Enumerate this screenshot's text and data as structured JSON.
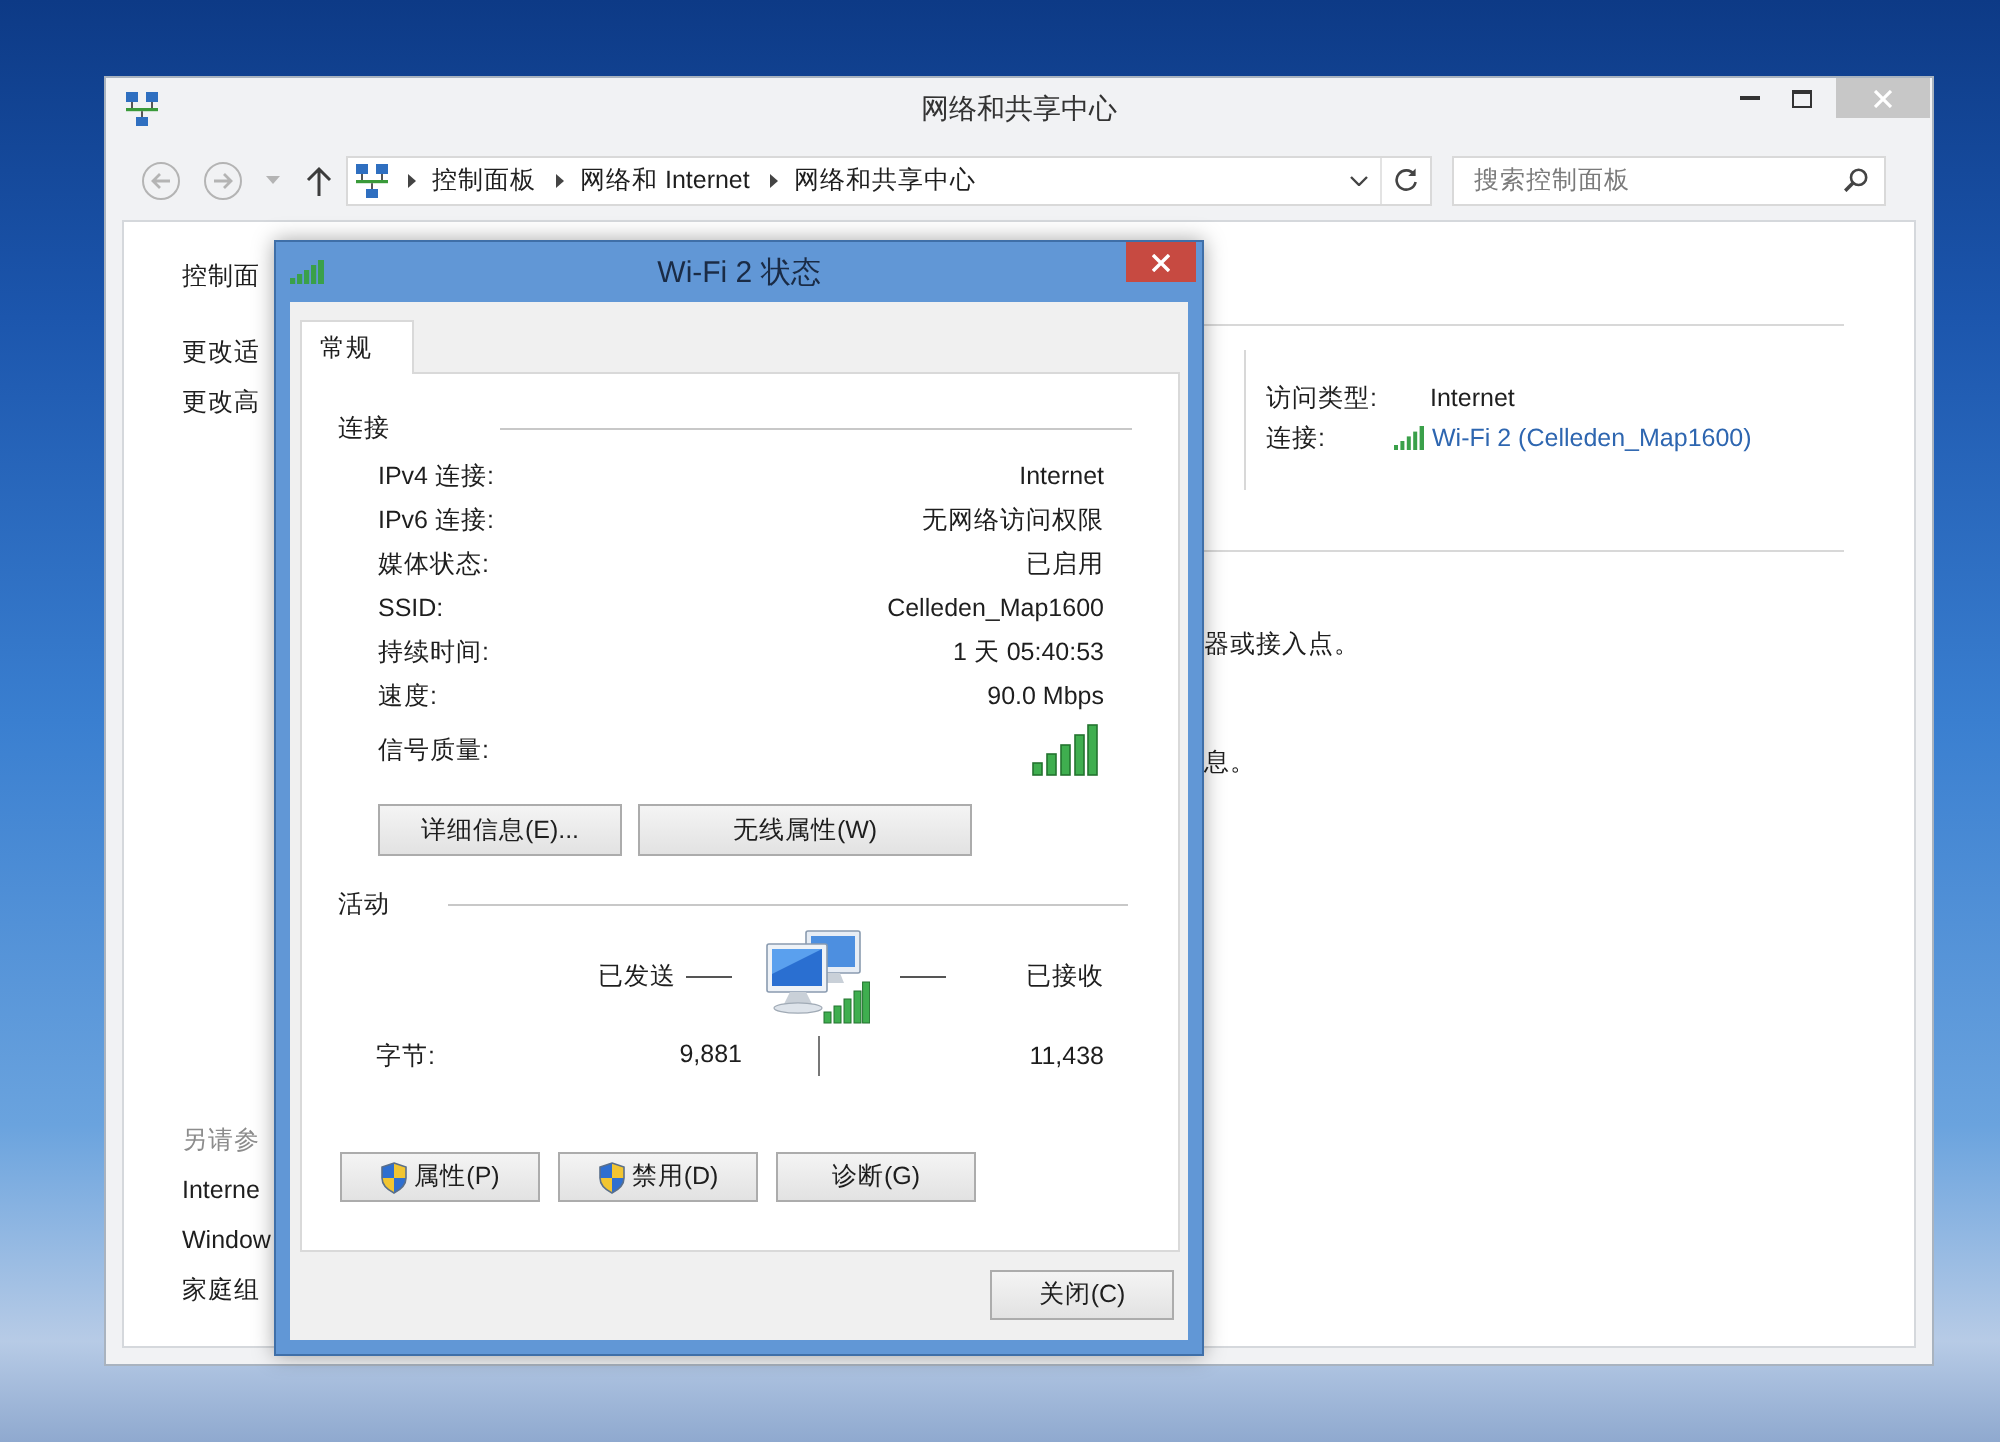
{
  "window": {
    "title": "网络和共享中心"
  },
  "navigation": [
    {
      "kind": "back",
      "disabled": true
    },
    {
      "kind": "forward",
      "disabled": true
    },
    {
      "kind": "recent",
      "disabled": true
    },
    {
      "kind": "up",
      "disabled": false
    }
  ],
  "address_bar": {
    "breadcrumbs": [
      "控制面板",
      "网络和 Internet",
      "网络和共享中心"
    ]
  },
  "search": {
    "placeholder": "搜索控制面板"
  },
  "sidebar": {
    "items": [
      "控制面",
      "更改适",
      "更改高"
    ],
    "see_also": {
      "heading": "另请参",
      "items": [
        "Interne",
        "Window",
        "家庭组"
      ]
    }
  },
  "network_info": {
    "rows": [
      {
        "label": "访问类型:",
        "value": "Internet",
        "kind": "text"
      },
      {
        "label": "连接:",
        "value": "Wi-Fi 2 (Celleden_Map1600)",
        "kind": "link"
      }
    ],
    "fragments": [
      "器或接入点。",
      "息。"
    ]
  },
  "dialog": {
    "title": "Wi-Fi 2 状态",
    "tabs": [
      {
        "label": "常规",
        "selected": true
      }
    ],
    "connection": {
      "heading": "连接",
      "rows": [
        {
          "label": "IPv4 连接:",
          "value": "Internet",
          "kind": "text"
        },
        {
          "label": "IPv6 连接:",
          "value": "无网络访问权限",
          "kind": "text"
        },
        {
          "label": "媒体状态:",
          "value": "已启用",
          "kind": "text"
        },
        {
          "label": "SSID:",
          "value": "Celleden_Map1600",
          "kind": "text"
        },
        {
          "label": "持续时间:",
          "value": "1 天 05:40:53",
          "kind": "text"
        },
        {
          "label": "速度:",
          "value": "90.0 Mbps",
          "kind": "text"
        },
        {
          "label": "信号质量:",
          "kind": "signal"
        }
      ],
      "buttons": [
        "详细信息(E)...",
        "无线属性(W)"
      ]
    },
    "activity": {
      "heading": "活动",
      "sent_label": "已发送",
      "received_label": "已接收",
      "bytes_label": "字节:",
      "bytes_sent": "9,881",
      "bytes_received": "11,438"
    },
    "action_buttons": [
      {
        "label": "属性(P)",
        "kind": "shield"
      },
      {
        "label": "禁用(D)",
        "kind": "shield"
      },
      {
        "label": "诊断(G)",
        "kind": "plain"
      }
    ],
    "close_button": "关闭(C)"
  }
}
